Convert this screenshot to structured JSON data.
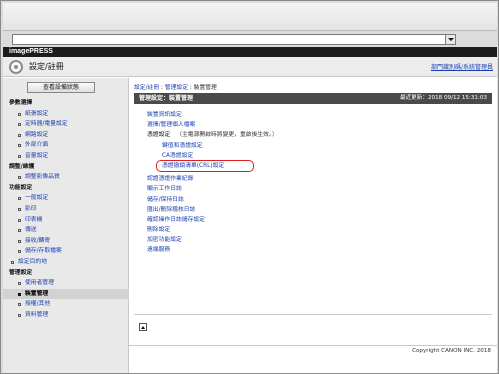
{
  "brand": "imagePRESS",
  "app_title": "設定/註冊",
  "admin_link": "部門識別碼/系統管理員",
  "status_button": "查看設備狀態",
  "sidebar": {
    "items": [
      {
        "label": "參數選擇",
        "level": "h"
      },
      {
        "label": "紙張設定",
        "level": "s"
      },
      {
        "label": "定時器/電量設定",
        "level": "s"
      },
      {
        "label": "網路設定",
        "level": "s"
      },
      {
        "label": "外部介面",
        "level": "s"
      },
      {
        "label": "音量設定",
        "level": "s"
      },
      {
        "label": "調整/維護",
        "level": "h"
      },
      {
        "label": "調整影像品質",
        "level": "s"
      },
      {
        "label": "功能設定",
        "level": "h"
      },
      {
        "label": "一般設定",
        "level": "s"
      },
      {
        "label": "影印",
        "level": "s"
      },
      {
        "label": "印表機",
        "level": "s"
      },
      {
        "label": "傳送",
        "level": "s"
      },
      {
        "label": "接收/轉寄",
        "level": "s"
      },
      {
        "label": "儲存/存取檔案",
        "level": "s"
      },
      {
        "label": "設定目的地",
        "level": "t"
      },
      {
        "label": "管理設定",
        "level": "h"
      },
      {
        "label": "使用者管理",
        "level": "s"
      },
      {
        "label": "裝置管理",
        "level": "s",
        "selected": true
      },
      {
        "label": "授權/其他",
        "level": "s"
      },
      {
        "label": "資料管理",
        "level": "s"
      }
    ]
  },
  "breadcrumb": {
    "part1": "設定/註冊",
    "part2": "管理設定",
    "part3": "裝置管理",
    "sep": " : "
  },
  "panel": {
    "title": "管理設定：裝置管理",
    "updated": "最近更新：2018 09/12 15:31:03"
  },
  "menu": [
    {
      "label": "裝置資訊設定",
      "type": "link"
    },
    {
      "label": "選擇/管理個人檔案",
      "type": "link"
    },
    {
      "label": "憑證設定",
      "type": "plain",
      "note": "（主電源開啟時將變更，重啟後生效。）"
    },
    {
      "label": "鍵值和憑證設定",
      "type": "sub"
    },
    {
      "label": "CA憑證設定",
      "type": "sub"
    },
    {
      "label": "憑證撤銷清單(CRL)設定",
      "type": "sub",
      "highlight": true
    },
    {
      "label": "認證憑證作業紀錄",
      "type": "link",
      "gap": true
    },
    {
      "label": "顯示工作日誌",
      "type": "link"
    },
    {
      "label": "儲存/保持日誌",
      "type": "link"
    },
    {
      "label": "匯出/刪除稽核日誌",
      "type": "link"
    },
    {
      "label": "確認操作日誌儲存設定",
      "type": "link"
    },
    {
      "label": "刪除設定",
      "type": "link"
    },
    {
      "label": "加密功能設定",
      "type": "link"
    },
    {
      "label": "遠端服務",
      "type": "link"
    }
  ],
  "footer": "Copyright CANON INC. 2018",
  "colors": {
    "link": "#1a3fb0",
    "header_bar": "#4a4a4a",
    "highlight": "#e0211b"
  }
}
